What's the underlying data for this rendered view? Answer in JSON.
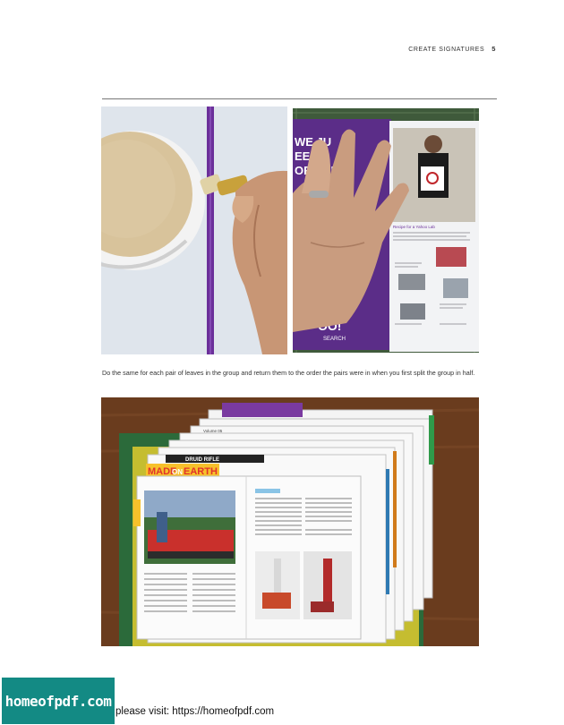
{
  "header": {
    "section": "CREATE SIGNATURES",
    "page_number": "5"
  },
  "photo2_text": {
    "lines": [
      "WE JU",
      "EED A",
      "ORE SP"
    ],
    "bottom": [
      "OO!",
      "SEARCH"
    ],
    "panel_heading": "Recipe for a Yahoo Lab"
  },
  "caption": "Do the same for each pair of leaves in the group and return them to the order the pairs were in when you first split the group in half.",
  "photo3_text": {
    "volume": "Volume 05",
    "banner": "DRUID RIFLE",
    "made": "MADE",
    "on": "ON",
    "earth": "EARTH"
  },
  "footer": {
    "logo": "homeofpdf.com",
    "text": "please visit: https://homeofpdf.com"
  },
  "colors": {
    "purple": "#6b2f9a",
    "mat_green": "#2f6b3c",
    "logo_teal": "#138a84"
  }
}
